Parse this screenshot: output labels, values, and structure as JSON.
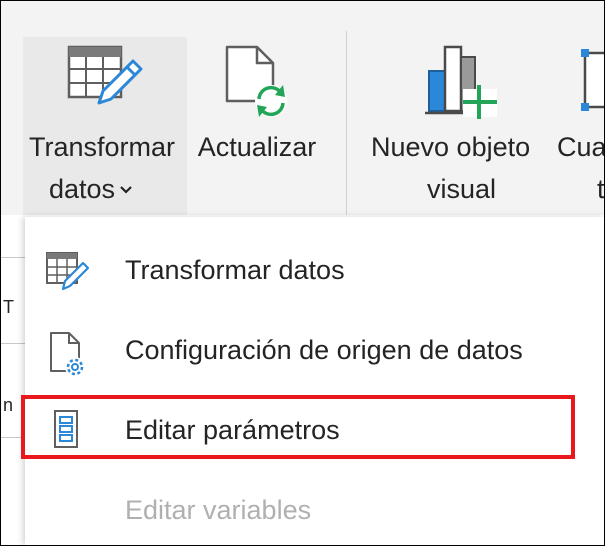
{
  "ribbon": {
    "transform_button": {
      "line1": "Transformar",
      "line2": "datos",
      "icon": "transform-data-icon"
    },
    "refresh_button": {
      "label": "Actualizar",
      "icon": "refresh-icon"
    },
    "new_visual_button": {
      "line1": "Nuevo objeto",
      "line2": "visual",
      "icon": "new-visual-icon"
    },
    "cut_button": {
      "line1": "Cua",
      "line2": "t",
      "icon": "text-box-icon"
    }
  },
  "background": {
    "glyphs": [
      "T",
      "n"
    ]
  },
  "menu": {
    "items": [
      {
        "label": "Transformar datos",
        "icon": "transform-data-icon",
        "enabled": true
      },
      {
        "label": "Configuración de origen de datos",
        "icon": "data-source-settings-icon",
        "enabled": true
      },
      {
        "label": "Editar parámetros",
        "icon": "edit-parameters-icon",
        "enabled": true,
        "highlighted": true
      },
      {
        "label": "Editar variables",
        "icon": "edit-variables-icon",
        "enabled": false
      }
    ]
  },
  "colors": {
    "highlight": "#e8181c",
    "accent_blue": "#2b88d8",
    "accent_green": "#22a559",
    "ribbon_bg": "#f3f3f3"
  }
}
